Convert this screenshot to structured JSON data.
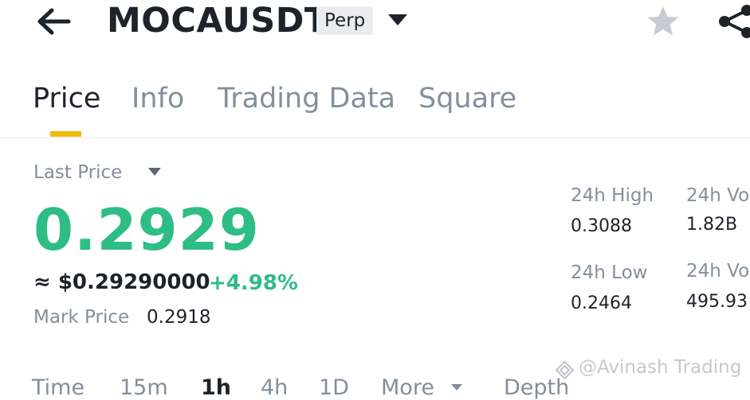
{
  "header": {
    "symbol": "MOCAUSDT",
    "contract_badge": "Perp",
    "icons": [
      "back-arrow-icon",
      "caret-down-icon",
      "star-icon",
      "share-icon"
    ]
  },
  "tabs": [
    {
      "label": "Price",
      "active": true
    },
    {
      "label": "Info",
      "active": false
    },
    {
      "label": "Trading Data",
      "active": false
    },
    {
      "label": "Square",
      "active": false
    }
  ],
  "price": {
    "last_label": "Last Price",
    "last_price": "0.2929",
    "usd_equivalent": "≈ $0.29290000",
    "change_pct": "+4.98%",
    "mark_label": "Mark Price",
    "mark_value": "0.2918"
  },
  "stats": {
    "high_label": "24h High",
    "high_value": "0.3088",
    "low_label": "24h Low",
    "low_value": "0.2464",
    "vol1_label": "24h Vo",
    "vol1_value": "1.82B",
    "vol2_label": "24h Vo",
    "vol2_value": "495.93"
  },
  "intervals": [
    "Time",
    "15m",
    "1h",
    "4h",
    "1D",
    "More",
    "Depth"
  ],
  "active_interval": "1h",
  "watermark": "@Avinash Trading",
  "colors": {
    "up_green": "#2ebd85",
    "accent_yellow": "#f0b90b",
    "text_primary": "#1e2329",
    "text_secondary": "#848e9c"
  }
}
